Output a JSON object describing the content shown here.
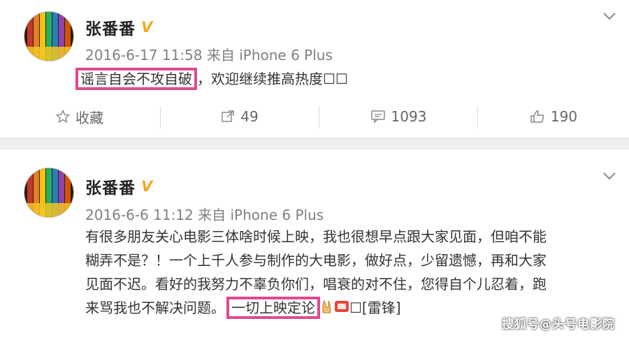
{
  "posts": [
    {
      "author": "张番番",
      "date": "2016-6-17 11:58",
      "source_prefix": "来自",
      "source": "iPhone 6 Plus",
      "highlighted_text": "谣言自会不攻自破",
      "body_rest": "，欢迎继续推高热度☐☐",
      "actions": {
        "favorite": "收藏",
        "repost": "49",
        "comment": "1093",
        "like": "190"
      }
    },
    {
      "author": "张番番",
      "date": "2016-6-6 11:12",
      "source_prefix": "来自",
      "source": "iPhone 6 Plus",
      "lines": [
        "有很多朋友关心电影三体啥时候上映，我也很想早点跟大家见面，但咱不能",
        "糊弄不是？！一个上千人参与制作的大电影，做好点，少留遗憾，再和大家",
        "见面不迟。看好的我努力不辜负你们，唱衰的对不住，您得自个儿忍着，跑",
        "来骂我也不解决问题。"
      ],
      "highlighted_text": "一切上映定论",
      "tail": "☐[雷锋]"
    }
  ],
  "verified_badge": "V",
  "watermark": "搜狐号@头号电影院",
  "colors": {
    "highlight_border": "#e04a8f",
    "badge": "#f5a623",
    "meta_text": "#808080"
  },
  "icons": [
    "star-icon",
    "repost-icon",
    "comment-icon",
    "like-icon",
    "chevron-down-icon",
    "verified-badge-icon"
  ]
}
